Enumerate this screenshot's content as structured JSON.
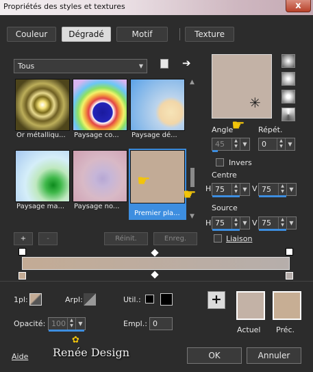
{
  "window": {
    "title": "Propriétés des styles et textures",
    "close_glyph": "x"
  },
  "tabs": [
    {
      "label": "Couleur",
      "active": false
    },
    {
      "label": "Dégradé",
      "active": true
    },
    {
      "label": "Motif",
      "active": false
    },
    {
      "label": "Texture",
      "active": false
    }
  ],
  "filter": {
    "value": "Tous"
  },
  "swatches": [
    {
      "label": "Or métalliqu...",
      "style": "radial"
    },
    {
      "label": "Paysage co...",
      "style": "rainbow"
    },
    {
      "label": "Paysage dé...",
      "style": "sun"
    },
    {
      "label": "Paysage ma...",
      "style": "green"
    },
    {
      "label": "Paysage no...",
      "style": "mauve"
    },
    {
      "label": "Premier pla...",
      "style": "fg",
      "selected": true
    }
  ],
  "list_buttons": {
    "add": "+",
    "remove": "-",
    "reset": "Réinit.",
    "save": "Enreg."
  },
  "angle": {
    "label": "Angle",
    "value": "45"
  },
  "repeat": {
    "label": "Répét.",
    "value": "0"
  },
  "invert": {
    "label": "Invers",
    "checked": false
  },
  "center": {
    "label": "Centre",
    "h_label": "H",
    "h": "75",
    "v_label": "V",
    "v": "75"
  },
  "source": {
    "label": "Source",
    "h_label": "H",
    "h": "75",
    "v_label": "V",
    "v": "75"
  },
  "link": {
    "label": "Liaison",
    "checked": false
  },
  "bottom": {
    "fg_label": "1pl:",
    "bg_label": "Arpl:",
    "util_label": "Util.:",
    "opacity_label": "Opacité:",
    "opacity_value": "100",
    "emplacement_label": "Empl.:",
    "emplacement_value": "0",
    "current_label": "Actuel",
    "previous_label": "Préc."
  },
  "footer": {
    "help": "Aide",
    "ok": "OK",
    "cancel": "Annuler",
    "logo": "Renée Design"
  },
  "colors": {
    "accent": "#3d8ee0",
    "gradient_start": "#c3ab95",
    "gradient_end": "#b6aeab",
    "current": "#c3b2a6",
    "previous": "#c7ae94"
  }
}
